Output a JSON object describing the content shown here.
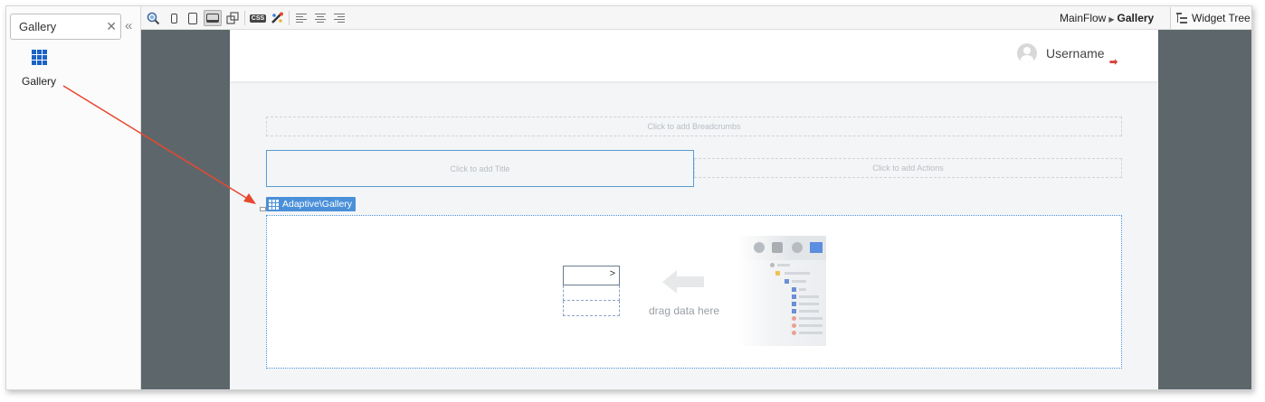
{
  "sidebar": {
    "search_value": "Gallery",
    "clear_glyph": "✕",
    "collapse_glyph": "«",
    "widget_label": "Gallery"
  },
  "toolbar": {
    "css_label": "CSS",
    "breadcrumb_flow": "MainFlow",
    "breadcrumb_sep": "▶",
    "breadcrumb_screen": "Gallery",
    "widget_tree_label": "Widget Tree"
  },
  "canvas": {
    "username": "Username",
    "logout_glyph": "➡",
    "breadcrumbs_placeholder": "Click to add Breadcrumbs",
    "title_placeholder": "Click to add Title",
    "actions_placeholder": "Click to add Actions",
    "widget_tag": "Adaptive\\Gallery",
    "list_arrow": ">",
    "drag_hint": "drag data here"
  },
  "colors": {
    "accent": "#4a90d9",
    "canvas_background": "#5d676b",
    "annotation_arrow": "#e8472e",
    "logout": "#d9413b"
  },
  "icons": [
    "search-icon",
    "phone-icon",
    "tablet-icon",
    "desktop-icon",
    "responsive-icon",
    "css-icon",
    "theme-icon",
    "align-left-icon",
    "align-center-icon",
    "align-right-icon",
    "widget-tree-icon",
    "gallery-grid-icon"
  ]
}
